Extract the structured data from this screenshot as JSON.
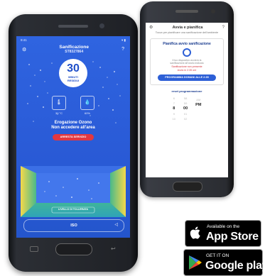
{
  "back_screen": {
    "title": "Avvia e pianifica",
    "description": "Tocca per pianificare una sanificazione dell'ambiente",
    "card_title": "Pianifica avvio sanificazione",
    "info_line_1": "Il tuo dispositivo avvierà la",
    "info_line_2": "sanificazione all'orario indicato",
    "warning_line_1": "Sanificazione non presente",
    "warning_line_2": "Avvio in 2:35 ore",
    "schedule_button": "PROGRAMMA DOMANI ALLE 2:35",
    "reset_link": "reset programmazione",
    "picker": {
      "hours": [
        "6",
        "7",
        "8",
        "9",
        "10"
      ],
      "minutes": [
        "58",
        "59",
        "00",
        "01",
        "02"
      ],
      "period": [
        "",
        "AM",
        "PM",
        "",
        ""
      ]
    }
  },
  "front_screen": {
    "status_time": "9:41",
    "status_right": "▾ ▮",
    "title": "Sanificazione",
    "subtitle": "ST8327864",
    "timer_value": "30",
    "timer_unit_1": "MINUTI",
    "timer_unit_2": "RESIDUI",
    "temperature": "30 °C",
    "humidity": "60%",
    "message_1": "Erogazione Ozono",
    "message_2": "Non accedere all'area",
    "stop_button": "ARRESTA SERVIZIO",
    "room_label": "LIVELLO DI TOLLERATA",
    "bottom_label": "ISO",
    "accent_color": "#2f64e0",
    "stop_color": "#e2373f"
  },
  "badges": {
    "apple_small": "Available on the",
    "apple_big": "App Store",
    "google_small": "GET IT ON",
    "google_big": "Google play"
  }
}
